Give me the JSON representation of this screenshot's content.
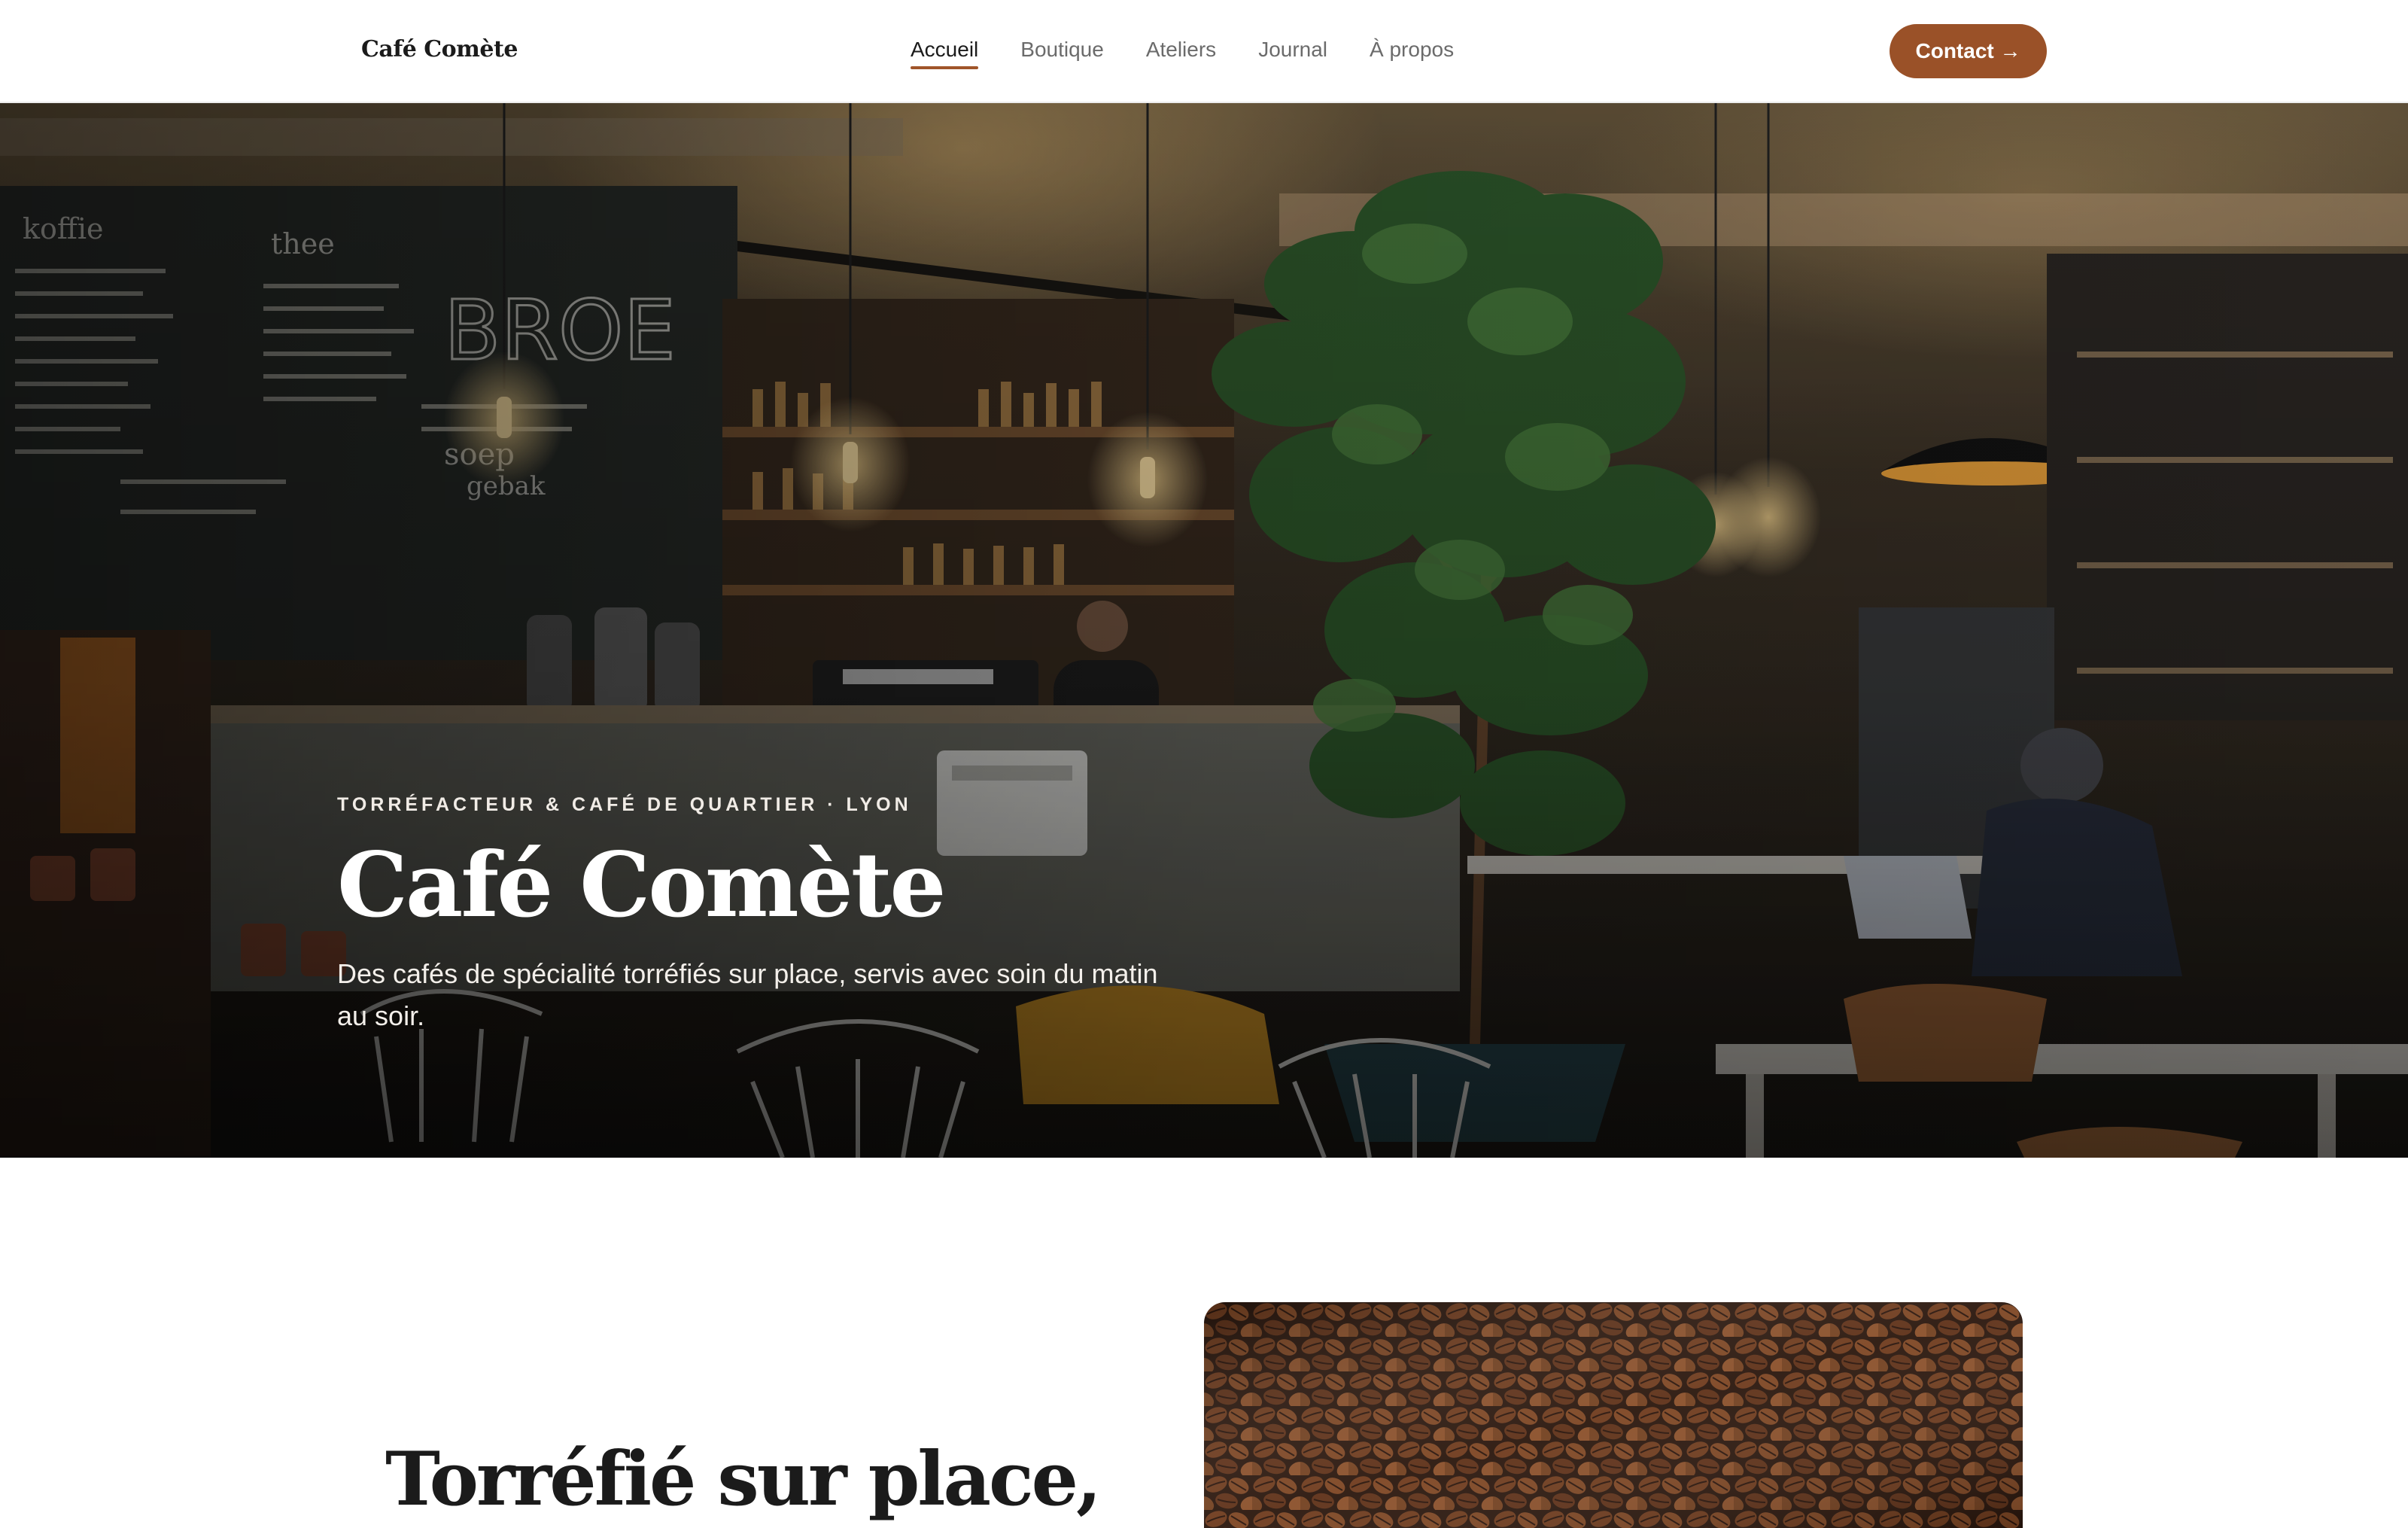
{
  "header": {
    "brand": "Café Comète",
    "nav": [
      {
        "label": "Accueil",
        "active": true
      },
      {
        "label": "Boutique",
        "active": false
      },
      {
        "label": "Ateliers",
        "active": false
      },
      {
        "label": "Journal",
        "active": false
      },
      {
        "label": "À propos",
        "active": false
      }
    ],
    "contact_label": "Contact →"
  },
  "hero": {
    "eyebrow": "TORRÉFACTEUR & CAFÉ DE QUARTIER · LYON",
    "title": "Café Comète",
    "subtitle": "Des cafés de spécialité torréfiés sur place, servis avec soin du matin au soir.",
    "image": "cafe-interior-photo"
  },
  "intro": {
    "heading": "Torréfié sur place,",
    "image": "coffee-beans-photo"
  },
  "colors": {
    "accent": "#9a5128",
    "text": "#1b1b1b",
    "muted": "#6b6b6b"
  }
}
